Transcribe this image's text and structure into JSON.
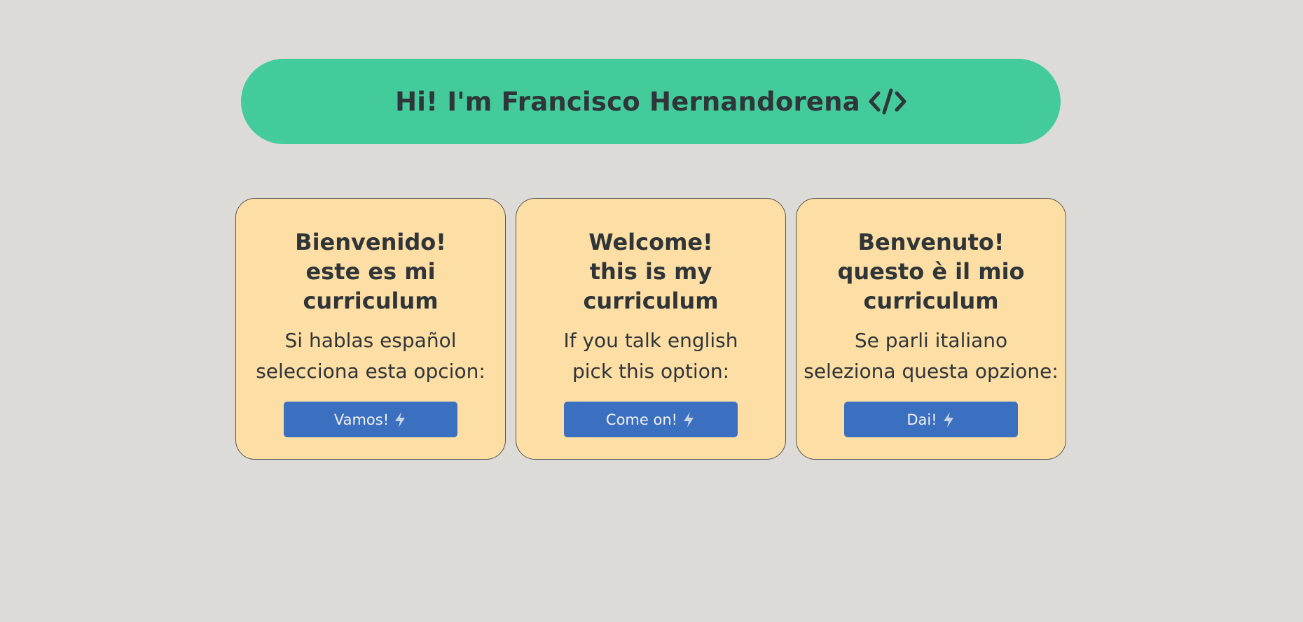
{
  "header": {
    "title": "Hi! I'm Francisco Hernandorena",
    "icon": "code-icon"
  },
  "colors": {
    "background": "#dcdbd8",
    "header_bg": "#43cb9b",
    "card_bg": "#fddea5",
    "button_bg": "#3b6fc0",
    "text": "#2f3538"
  },
  "cards": [
    {
      "title": "Bienvenido!\neste es mi\ncurriculum",
      "text": "Si hablas español\nselecciona esta opcion:",
      "button_label": "Vamos!",
      "button_icon": "lightning-icon"
    },
    {
      "title": "Welcome!\nthis is my\ncurriculum",
      "text": "If you talk english\npick this option:",
      "button_label": "Come on!",
      "button_icon": "lightning-icon"
    },
    {
      "title": "Benvenuto!\nquesto è il mio\ncurriculum",
      "text": "Se parli italiano\nseleziona questa opzione:",
      "button_label": "Dai!",
      "button_icon": "lightning-icon"
    }
  ]
}
